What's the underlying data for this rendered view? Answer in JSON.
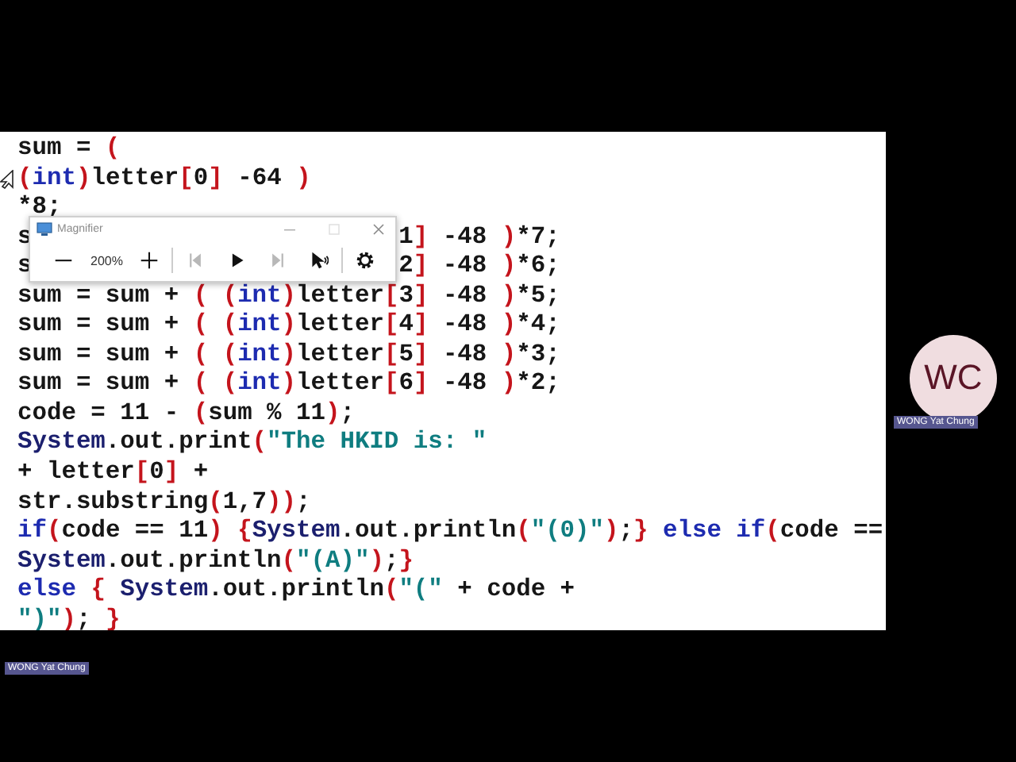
{
  "code": {
    "lines": [
      {
        "tokens": [
          {
            "kind": "plain",
            "text": "sum = "
          },
          {
            "kind": "punct",
            "text": "("
          }
        ]
      },
      {
        "pointer": true,
        "tokens": [
          {
            "kind": "punct",
            "text": "("
          },
          {
            "kind": "keyword",
            "text": "int"
          },
          {
            "kind": "punct",
            "text": ")"
          },
          {
            "kind": "plain",
            "text": "letter"
          },
          {
            "kind": "punct",
            "text": "["
          },
          {
            "kind": "plain",
            "text": "0"
          },
          {
            "kind": "punct",
            "text": "]"
          },
          {
            "kind": "plain",
            "text": " -64 "
          },
          {
            "kind": "punct",
            "text": ")"
          }
        ]
      },
      {
        "tokens": [
          {
            "kind": "plain",
            "text": "*8;"
          }
        ]
      },
      {
        "tokens": [
          {
            "kind": "plain",
            "text": "s"
          }
        ],
        "after": [
          {
            "kind": "plain",
            "text": "1"
          },
          {
            "kind": "punct",
            "text": "]"
          },
          {
            "kind": "plain",
            "text": " -48 "
          },
          {
            "kind": "punct",
            "text": ")"
          },
          {
            "kind": "plain",
            "text": "*7;"
          }
        ]
      },
      {
        "tokens": [
          {
            "kind": "plain",
            "text": "s"
          }
        ],
        "after": [
          {
            "kind": "plain",
            "text": "2"
          },
          {
            "kind": "punct",
            "text": "]"
          },
          {
            "kind": "plain",
            "text": " -48 "
          },
          {
            "kind": "punct",
            "text": ")"
          },
          {
            "kind": "plain",
            "text": "*6;"
          }
        ]
      },
      {
        "tokens": [
          {
            "kind": "plain",
            "text": "sum = sum + "
          },
          {
            "kind": "punct",
            "text": "( ("
          },
          {
            "kind": "keyword",
            "text": "int"
          },
          {
            "kind": "punct",
            "text": ")"
          },
          {
            "kind": "plain",
            "text": "letter"
          },
          {
            "kind": "punct",
            "text": "["
          },
          {
            "kind": "plain",
            "text": "3"
          },
          {
            "kind": "punct",
            "text": "]"
          },
          {
            "kind": "plain",
            "text": " -48 "
          },
          {
            "kind": "punct",
            "text": ")"
          },
          {
            "kind": "plain",
            "text": "*5;"
          }
        ]
      },
      {
        "tokens": [
          {
            "kind": "plain",
            "text": "sum = sum + "
          },
          {
            "kind": "punct",
            "text": "( ("
          },
          {
            "kind": "keyword",
            "text": "int"
          },
          {
            "kind": "punct",
            "text": ")"
          },
          {
            "kind": "plain",
            "text": "letter"
          },
          {
            "kind": "punct",
            "text": "["
          },
          {
            "kind": "plain",
            "text": "4"
          },
          {
            "kind": "punct",
            "text": "]"
          },
          {
            "kind": "plain",
            "text": " -48 "
          },
          {
            "kind": "punct",
            "text": ")"
          },
          {
            "kind": "plain",
            "text": "*4;"
          }
        ]
      },
      {
        "tokens": [
          {
            "kind": "plain",
            "text": "sum = sum + "
          },
          {
            "kind": "punct",
            "text": "( ("
          },
          {
            "kind": "keyword",
            "text": "int"
          },
          {
            "kind": "punct",
            "text": ")"
          },
          {
            "kind": "plain",
            "text": "letter"
          },
          {
            "kind": "punct",
            "text": "["
          },
          {
            "kind": "plain",
            "text": "5"
          },
          {
            "kind": "punct",
            "text": "]"
          },
          {
            "kind": "plain",
            "text": " -48 "
          },
          {
            "kind": "punct",
            "text": ")"
          },
          {
            "kind": "plain",
            "text": "*3;"
          }
        ]
      },
      {
        "tokens": [
          {
            "kind": "plain",
            "text": "sum = sum + "
          },
          {
            "kind": "punct",
            "text": "( ("
          },
          {
            "kind": "keyword",
            "text": "int"
          },
          {
            "kind": "punct",
            "text": ")"
          },
          {
            "kind": "plain",
            "text": "letter"
          },
          {
            "kind": "punct",
            "text": "["
          },
          {
            "kind": "plain",
            "text": "6"
          },
          {
            "kind": "punct",
            "text": "]"
          },
          {
            "kind": "plain",
            "text": " -48 "
          },
          {
            "kind": "punct",
            "text": ")"
          },
          {
            "kind": "plain",
            "text": "*2;"
          }
        ]
      },
      {
        "tokens": [
          {
            "kind": "plain",
            "text": "code = 11 - "
          },
          {
            "kind": "punct",
            "text": "("
          },
          {
            "kind": "plain",
            "text": "sum % 11"
          },
          {
            "kind": "punct",
            "text": ")"
          },
          {
            "kind": "plain",
            "text": ";"
          }
        ]
      },
      {
        "tokens": [
          {
            "kind": "class",
            "text": "System"
          },
          {
            "kind": "plain",
            "text": ".out.print"
          },
          {
            "kind": "punct",
            "text": "("
          },
          {
            "kind": "string",
            "text": "\"The HKID is: \""
          }
        ]
      },
      {
        "tokens": [
          {
            "kind": "plain",
            "text": "+ letter"
          },
          {
            "kind": "punct",
            "text": "["
          },
          {
            "kind": "plain",
            "text": "0"
          },
          {
            "kind": "punct",
            "text": "]"
          },
          {
            "kind": "plain",
            "text": " +"
          }
        ]
      },
      {
        "tokens": [
          {
            "kind": "plain",
            "text": "str.substring"
          },
          {
            "kind": "punct",
            "text": "("
          },
          {
            "kind": "plain",
            "text": "1,7"
          },
          {
            "kind": "punct",
            "text": "))"
          },
          {
            "kind": "plain",
            "text": ";"
          }
        ]
      },
      {
        "tokens": [
          {
            "kind": "keyword",
            "text": "if"
          },
          {
            "kind": "punct",
            "text": "("
          },
          {
            "kind": "plain",
            "text": "code == 11"
          },
          {
            "kind": "punct",
            "text": ") {"
          },
          {
            "kind": "class",
            "text": "System"
          },
          {
            "kind": "plain",
            "text": ".out.println"
          },
          {
            "kind": "punct",
            "text": "("
          },
          {
            "kind": "string",
            "text": "\"(0)\""
          },
          {
            "kind": "punct",
            "text": ")"
          },
          {
            "kind": "plain",
            "text": ";"
          },
          {
            "kind": "punct",
            "text": "}"
          },
          {
            "kind": "keyword",
            "text": " else if"
          },
          {
            "kind": "punct",
            "text": "("
          },
          {
            "kind": "plain",
            "text": "code =="
          }
        ]
      },
      {
        "tokens": [
          {
            "kind": "class",
            "text": "System"
          },
          {
            "kind": "plain",
            "text": ".out.println"
          },
          {
            "kind": "punct",
            "text": "("
          },
          {
            "kind": "string",
            "text": "\"(A)\""
          },
          {
            "kind": "punct",
            "text": ")"
          },
          {
            "kind": "plain",
            "text": ";"
          },
          {
            "kind": "punct",
            "text": "}"
          }
        ]
      },
      {
        "tokens": [
          {
            "kind": "keyword",
            "text": "else "
          },
          {
            "kind": "punct",
            "text": "{ "
          },
          {
            "kind": "class",
            "text": "System"
          },
          {
            "kind": "plain",
            "text": ".out.println"
          },
          {
            "kind": "punct",
            "text": "("
          },
          {
            "kind": "string",
            "text": "\"(\""
          },
          {
            "kind": "plain",
            "text": " + code +"
          }
        ]
      },
      {
        "tokens": [
          {
            "kind": "string",
            "text": "\")\""
          },
          {
            "kind": "punct",
            "text": ")"
          },
          {
            "kind": "plain",
            "text": "; "
          },
          {
            "kind": "punct",
            "text": "}"
          }
        ]
      }
    ]
  },
  "magnifier": {
    "title": "Magnifier",
    "zoom": "200%",
    "buttons": [
      {
        "kind": "zoom-out",
        "disabled": false
      },
      {
        "kind": "zoom-in",
        "disabled": false
      },
      {
        "kind": "previous",
        "disabled": true
      },
      {
        "kind": "play",
        "disabled": false
      },
      {
        "kind": "next",
        "disabled": true
      },
      {
        "kind": "follow",
        "disabled": false
      },
      {
        "kind": "settings",
        "disabled": false
      }
    ]
  },
  "participant": {
    "initials": "WC",
    "name": "WONG Yat Chung"
  },
  "presenter_label": "WONG Yat Chung"
}
